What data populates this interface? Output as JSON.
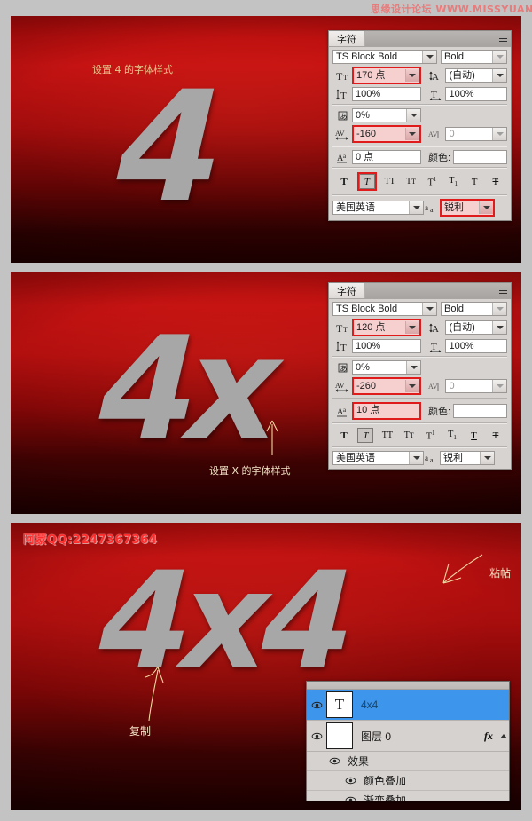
{
  "watermarks": {
    "top": "思缘设计论坛 WWW.MISSYUAN.COM",
    "qq": "阿蒙QQ:2247367364"
  },
  "panels": [
    {
      "id": "step-1",
      "artwork_text": "4",
      "annotation": "设置 4 的字体样式",
      "character_palette": {
        "tab_label": "字符",
        "font_family": "TS Block Bold",
        "font_style": "Bold",
        "font_size": "170 点",
        "leading": "(自动)",
        "vertical_scale": "100%",
        "horizontal_scale": "100%",
        "tsume": "0%",
        "tracking": "-160",
        "kerning": "0",
        "baseline_shift": "0 点",
        "color_label": "颜色:",
        "color_value": "#ffffff",
        "language": "美国英语",
        "anti_alias": "锐利",
        "style_buttons": [
          "T",
          "T",
          "TT",
          "Tr",
          "T¹",
          "T₁",
          "T",
          "Ŧ"
        ],
        "active_style_index": 1,
        "highlighted_fields": [
          "font_size",
          "tracking",
          "anti_alias",
          "style_italic"
        ]
      }
    },
    {
      "id": "step-2",
      "artwork_text": "4x",
      "annotation": "设置 X 的字体样式",
      "character_palette": {
        "tab_label": "字符",
        "font_family": "TS Block Bold",
        "font_style": "Bold",
        "font_size": "120 点",
        "leading": "(自动)",
        "vertical_scale": "100%",
        "horizontal_scale": "100%",
        "tsume": "0%",
        "tracking": "-260",
        "kerning": "0",
        "baseline_shift": "10 点",
        "color_label": "颜色:",
        "color_value": "#ffffff",
        "language": "美国英语",
        "anti_alias": "锐利",
        "style_buttons": [
          "T",
          "T",
          "TT",
          "Tr",
          "T¹",
          "T₁",
          "T",
          "Ŧ"
        ],
        "active_style_index": 1,
        "highlighted_fields": [
          "font_size",
          "tracking",
          "baseline_shift"
        ]
      }
    },
    {
      "id": "step-3",
      "artwork_text": "4x4",
      "annotation_copy": "复制",
      "annotation_paste": "粘帖",
      "layers_palette": {
        "layers": [
          {
            "name": "4x4",
            "thumb": "T",
            "selected": true,
            "visible": true,
            "has_fx": false
          },
          {
            "name": "图层 0",
            "thumb": "",
            "selected": false,
            "visible": true,
            "has_fx": true
          }
        ],
        "effects_group": "效果",
        "effects": [
          "颜色叠加",
          "渐变叠加"
        ]
      }
    }
  ],
  "colors": {
    "accent_red": "#e01b1b",
    "selection_blue": "#3d95ec",
    "artwork_gray": "#a7a7a7",
    "panel_gray": "#d7d3d0",
    "page_background": "#c3c3c3"
  }
}
